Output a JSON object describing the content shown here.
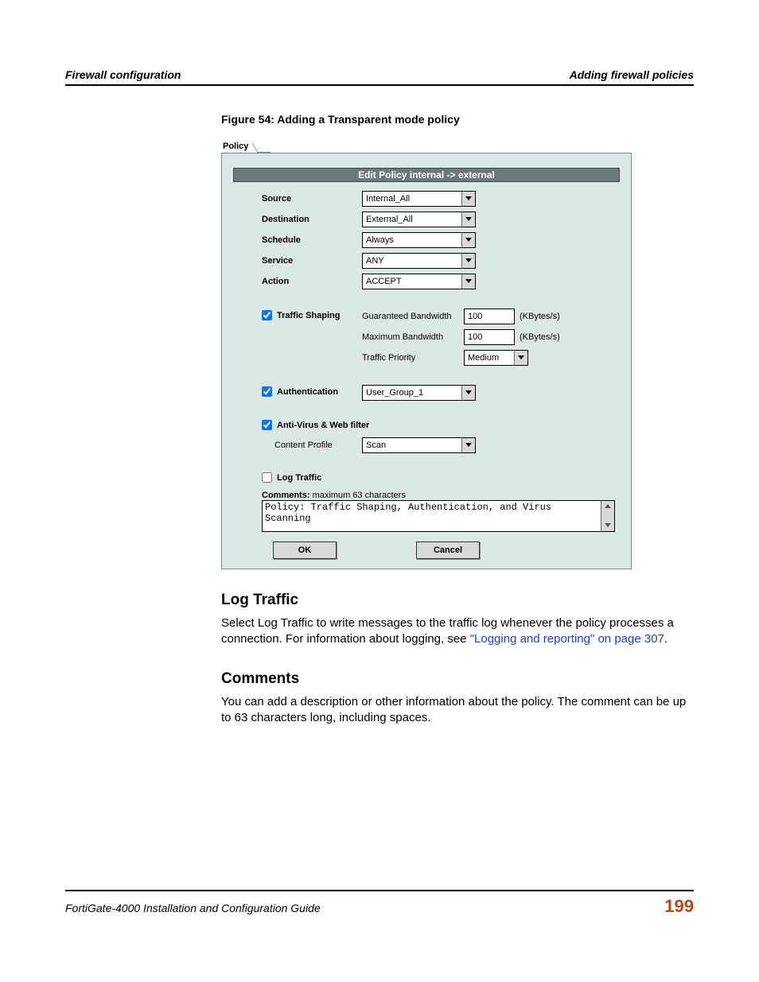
{
  "header": {
    "left": "Firewall configuration",
    "right": "Adding firewall policies"
  },
  "figure_caption": "Figure 54: Adding a Transparent mode policy",
  "tab": {
    "label": "Policy"
  },
  "edit_bar": "Edit Policy internal -> external",
  "fields": {
    "source": {
      "label": "Source",
      "value": "Internal_All"
    },
    "destination": {
      "label": "Destination",
      "value": "External_All"
    },
    "schedule": {
      "label": "Schedule",
      "value": "Always"
    },
    "service": {
      "label": "Service",
      "value": "ANY"
    },
    "action": {
      "label": "Action",
      "value": "ACCEPT"
    }
  },
  "traffic_shaping": {
    "label": "Traffic Shaping",
    "guaranteed_label": "Guaranteed Bandwidth",
    "guaranteed_value": "100",
    "maximum_label": "Maximum Bandwidth",
    "maximum_value": "100",
    "unit": "(KBytes/s)",
    "priority_label": "Traffic Priority",
    "priority_value": "Medium"
  },
  "authentication": {
    "label": "Authentication",
    "value": "User_Group_1"
  },
  "antivirus": {
    "label": "Anti-Virus & Web filter",
    "content_profile_label": "Content Profile",
    "content_profile_value": "Scan"
  },
  "log_traffic": {
    "label": "Log Traffic"
  },
  "comments_meta": {
    "label": "Comments:",
    "hint": " maximum 63 characters",
    "value": "Policy: Traffic Shaping, Authentication, and Virus Scanning"
  },
  "buttons": {
    "ok": "OK",
    "cancel": "Cancel"
  },
  "sections": {
    "log_heading": "Log Traffic",
    "log_para_pre": "Select Log Traffic to write messages to the traffic log whenever the policy processes a connection. For information about logging, see ",
    "log_link": "\"Logging and reporting\" on page 307",
    "log_para_post": ".",
    "comments_heading": "Comments",
    "comments_para": "You can add a description or other information about the policy. The comment can be up to 63 characters long, including spaces."
  },
  "footer": {
    "title": "FortiGate-4000 Installation and Configuration Guide",
    "page": "199"
  }
}
